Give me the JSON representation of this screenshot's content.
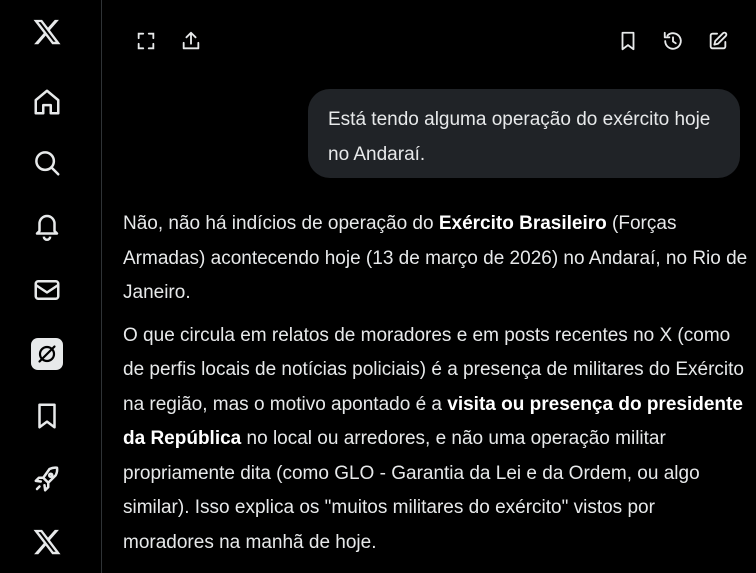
{
  "sidebar": {
    "items": [
      {
        "icon": "x-logo-icon"
      },
      {
        "icon": "home-icon"
      },
      {
        "icon": "search-icon"
      },
      {
        "icon": "bell-icon"
      },
      {
        "icon": "mail-icon"
      },
      {
        "icon": "grok-icon",
        "active": true
      },
      {
        "icon": "bookmark-icon"
      },
      {
        "icon": "rocket-icon"
      },
      {
        "icon": "x-premium-icon"
      }
    ]
  },
  "toolbar": {
    "left": [
      "fullscreen-icon",
      "share-icon"
    ],
    "right": [
      "bookmark-icon",
      "history-icon",
      "new-chat-icon"
    ]
  },
  "conversation": {
    "user_message": "Está tendo alguma operação do exército hoje no Andaraí.",
    "answer": {
      "p1": {
        "a": "Não, não há indícios de operação do ",
        "b": "Exército Brasileiro",
        "c": " (Forças Armadas) acontecendo hoje (13 de março de 2026) no Andaraí, no Rio de Janeiro."
      },
      "p2": {
        "a": "O que circula em relatos de moradores e em posts recentes no X (como de perfis locais de notícias policiais) é a presença de militares do Exército na região, mas o motivo apontado é a ",
        "b": "visita ou presença do presidente da República",
        "c": " no local ou arredores, e não uma operação militar propriamente dita (como GLO - Garantia da Lei e da Ordem, ou algo similar). Isso explica os \"muitos militares do exército\" vistos por moradores na manhã de hoje."
      }
    }
  },
  "colors": {
    "background": "#000000",
    "text": "#e7e9ea",
    "bubble": "#202327",
    "divider": "#2f3336"
  }
}
